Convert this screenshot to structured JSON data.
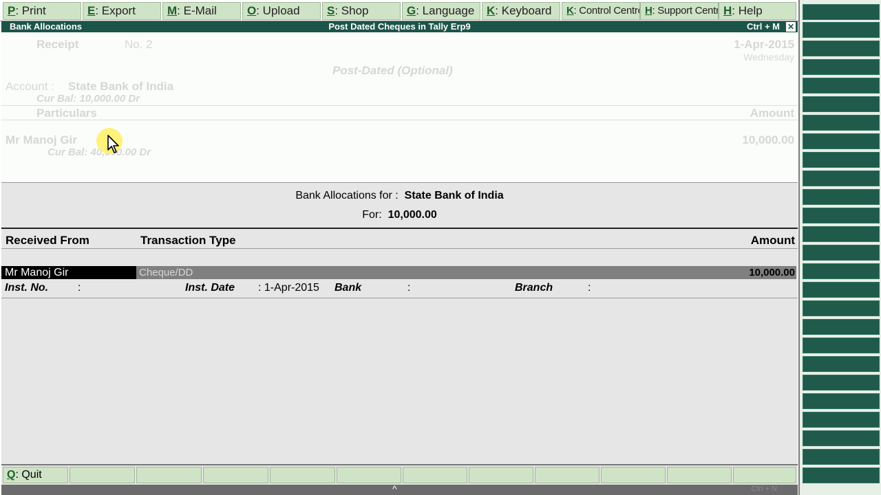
{
  "menu": [
    {
      "key": "P",
      "label": ": Print"
    },
    {
      "key": "E",
      "label": ": Export"
    },
    {
      "key": "M",
      "label": ": E-Mail"
    },
    {
      "key": "O",
      "label": ": Upload"
    },
    {
      "key": "S",
      "label": ": Shop"
    },
    {
      "key": "G",
      "label": ": Language"
    },
    {
      "key": "K",
      "label": ": Keyboard"
    },
    {
      "key": "K",
      "label": ": Control Centre"
    },
    {
      "key": "H",
      "label": ": Support Centre"
    },
    {
      "key": "H",
      "label": ": Help"
    }
  ],
  "titlebar": {
    "left": "Bank Allocations",
    "center": "Post Dated Cheques in Tally Erp9",
    "right": "Ctrl + M",
    "close": "✕"
  },
  "voucher": {
    "type": "Receipt",
    "number": "No. 2",
    "date": "1-Apr-2015",
    "day": "Wednesday",
    "post_dated": "Post-Dated (Optional)",
    "account_label": "Account :",
    "account_name": "State Bank of India",
    "account_curbal": "Cur Bal:  10,000.00 Dr",
    "particulars_header": "Particulars",
    "amount_header": "Amount",
    "party_name": "Mr Manoj Gir",
    "party_curbal": "Cur Bal:  40,000.00 Dr",
    "party_amount": "10,000.00"
  },
  "allocation": {
    "for_label": "Bank Allocations for :",
    "bank_name": "State Bank of India",
    "amount_label": "For:",
    "amount_value": "10,000.00",
    "col_received_from": "Received From",
    "col_transaction_type": "Transaction Type",
    "col_amount": "Amount",
    "row": {
      "received_from": "Mr Manoj Gir",
      "transaction_type": "Cheque/DD",
      "amount": "10,000.00"
    },
    "inst_no_label": "Inst. No.",
    "inst_no_colon": ":",
    "inst_date_label": "Inst. Date",
    "inst_date_value": ": 1-Apr-2015",
    "bank_label": "Bank",
    "bank_colon": ":",
    "branch_label": "Branch",
    "branch_colon": ":"
  },
  "bottom": {
    "quit_key": "Q",
    "quit_label": ": Quit",
    "caret": "^",
    "ctrl": "Ctrl + N"
  },
  "colors": {
    "title_bg": "#1b5549",
    "menu_button": "#cfe3c6",
    "panel_button": "#1f5a4b",
    "selection": "#000000"
  }
}
